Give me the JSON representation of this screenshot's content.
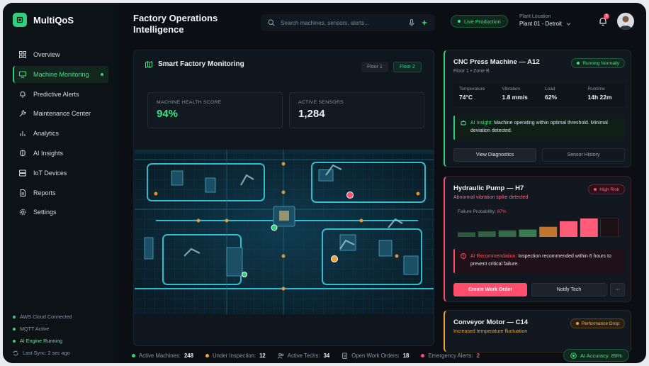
{
  "app": {
    "name": "MultiQoS"
  },
  "header": {
    "title": "Factory Operations Intelligence",
    "search_placeholder": "Search machines, sensors, alerts...",
    "live_label": "Live Production",
    "plant_label": "Plant Location",
    "plant_value": "Plant 01 - Detroit",
    "notification_count": "3"
  },
  "sidebar": {
    "items": [
      {
        "label": "Overview",
        "icon": "grid-icon"
      },
      {
        "label": "Machine Monitoring",
        "icon": "monitor-icon",
        "active": true
      },
      {
        "label": "Predictive Alerts",
        "icon": "bell-icon"
      },
      {
        "label": "Maintenance Center",
        "icon": "wrench-icon"
      },
      {
        "label": "Analytics",
        "icon": "bar-chart-icon"
      },
      {
        "label": "AI Insights",
        "icon": "brain-icon"
      },
      {
        "label": "IoT Devices",
        "icon": "server-icon"
      },
      {
        "label": "Reports",
        "icon": "file-icon"
      },
      {
        "label": "Settings",
        "icon": "gear-icon"
      }
    ],
    "status": [
      {
        "label": "AWS Cloud Connected"
      },
      {
        "label": "MQTT Active"
      },
      {
        "label": "AI Engine Running"
      },
      {
        "label": "Last Sync: 2 sec ago"
      }
    ]
  },
  "main": {
    "title": "Smart Factory Monitoring",
    "floors": [
      "Floor 1",
      "Floor 2"
    ],
    "active_floor": "Floor 2",
    "cards": [
      {
        "label": "MACHINE HEALTH SCORE",
        "value": "94%",
        "color": "#3ee28a"
      },
      {
        "label": "ACTIVE SENSORS",
        "value": "1,284",
        "color": "#ffffff"
      }
    ]
  },
  "machines": {
    "cnc": {
      "title": "CNC Press Machine — A12",
      "sub": "Floor 1 • Zone B",
      "status": "Running Normally",
      "metrics": [
        {
          "label": "Temperature",
          "value": "74°C"
        },
        {
          "label": "Vibration",
          "value": "1.8 mm/s"
        },
        {
          "label": "Load",
          "value": "62%"
        },
        {
          "label": "Runtime",
          "value": "14h 22m"
        }
      ],
      "insight_key": "AI Insight:",
      "insight_text": "Machine operating within optimal threshold. Minimal deviation detected.",
      "btn_primary": "View Diagnostics",
      "btn_secondary": "Sensor History"
    },
    "pump": {
      "title": "Hydraulic Pump — H7",
      "sub": "Abnormal vibration spike detected",
      "status": "High Risk",
      "prob_label": "Failure Probability:",
      "prob_value": "87%",
      "prob_levels": [
        0.25,
        0.3,
        0.35,
        0.4,
        0.55,
        0.85,
        1.0,
        0.0
      ],
      "alert_key": "AI Recommendation:",
      "alert_text": "Inspection recommended within 6 hours to prevent critical failure.",
      "btn_primary": "Create Work Order",
      "btn_secondary": "Notify Tech",
      "btn_more": "···"
    },
    "conveyor": {
      "title": "Conveyor Motor — C14",
      "sub": "Increased temperature fluctuation",
      "status": "Performance Drop"
    }
  },
  "footer": {
    "items": [
      {
        "label": "Active Machines:",
        "value": "248",
        "color": "#2fd27a"
      },
      {
        "label": "Under Inspection:",
        "value": "12",
        "color": "#f0a23a"
      },
      {
        "label": "Active Techs:",
        "value": "34",
        "color": "#8a96a3"
      },
      {
        "label": "Open Work Orders:",
        "value": "18",
        "color": "#8a96a3"
      },
      {
        "label": "Emergency Alerts:",
        "value": "2",
        "color": "#ff4d6d"
      }
    ],
    "accuracy": "AI Accuracy: 89%"
  }
}
